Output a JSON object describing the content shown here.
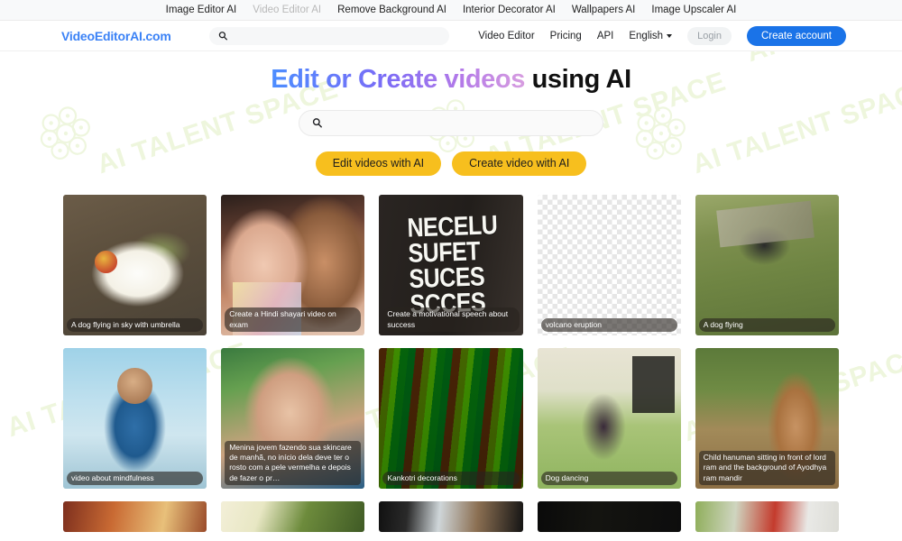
{
  "topbar": {
    "links": [
      {
        "label": "Image Editor AI",
        "muted": false
      },
      {
        "label": "Video Editor AI",
        "muted": true
      },
      {
        "label": "Remove Background AI",
        "muted": false
      },
      {
        "label": "Interior Decorator AI",
        "muted": false
      },
      {
        "label": "Wallpapers AI",
        "muted": false
      },
      {
        "label": "Image Upscaler AI",
        "muted": false
      }
    ]
  },
  "header": {
    "logo": "VideoEditorAI.com",
    "search_value": "",
    "search_placeholder": "",
    "search_icon": "search-icon",
    "nav": [
      {
        "label": "Video Editor"
      },
      {
        "label": "Pricing"
      },
      {
        "label": "API"
      }
    ],
    "language": "English",
    "login_label": "Login",
    "create_account_label": "Create account",
    "accent_color": "#1a73e8",
    "logo_color": "#3b82f6"
  },
  "hero": {
    "title_gradient": "Edit or Create videos",
    "title_plain": " using AI",
    "search_value": "",
    "search_placeholder": "",
    "search_icon": "search-icon",
    "cta_primary": "Edit videos with AI",
    "cta_secondary": "Create video with AI",
    "cta_color": "#f7bf1e"
  },
  "watermark": {
    "text": "AI TALENT SPACE",
    "color": "#eef6dd"
  },
  "gallery": {
    "cards": [
      {
        "caption": "A dog flying in sky with umbrella",
        "art": "art-dog-umbrella"
      },
      {
        "caption": "Create a Hindi shayari video on exam",
        "art": "art-couple"
      },
      {
        "caption": "Create a motivational speech about success",
        "art": "art-success",
        "art_text": "NECELU\nSUFET\nSUCES\nSCCES"
      },
      {
        "caption": "volcano eruption",
        "art": "art-checker"
      },
      {
        "caption": "A dog flying",
        "art": "art-dogfly"
      },
      {
        "caption": "video about mindfulness",
        "art": "art-mindful"
      },
      {
        "caption": "Menina jovem fazendo sua skincare de manhã, no início dela deve ter o rosto com a pele vermelha e depois de fazer o pr…",
        "art": "art-skincare"
      },
      {
        "caption": "Kankotri decorations",
        "art": "art-kankotri"
      },
      {
        "caption": "Dog dancing",
        "art": "art-dogdance"
      },
      {
        "caption": "Child hanuman sitting in front of lord ram and the background of Ayodhya ram mandir",
        "art": "art-hanuman"
      }
    ],
    "partial_row": [
      {
        "art": "art-strip-1"
      },
      {
        "art": "art-strip-2"
      },
      {
        "art": "art-strip-3"
      },
      {
        "art": "art-strip-4"
      },
      {
        "art": "art-strip-5"
      }
    ]
  }
}
